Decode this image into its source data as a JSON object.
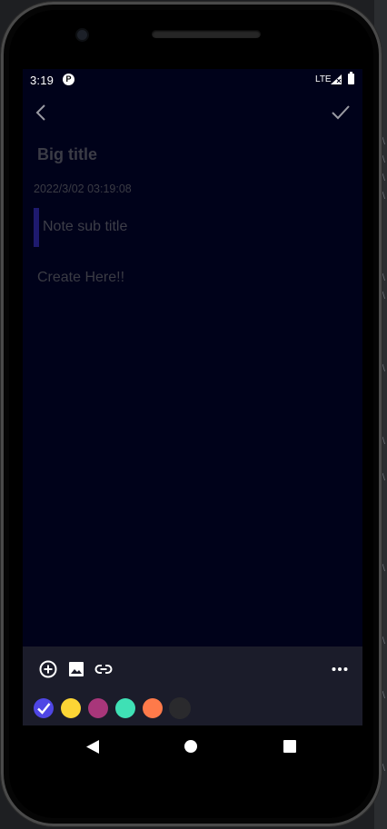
{
  "status_bar": {
    "time": "3:19",
    "app_badge": "P",
    "network": "LTE"
  },
  "header": {
    "back_icon": "chevron-left-icon",
    "save_icon": "check-icon"
  },
  "note": {
    "title": "Big title",
    "timestamp": "2022/3/02 03:19:08",
    "subtitle": "Note sub title",
    "body_placeholder": "Create Here!!"
  },
  "toolbar": {
    "actions": [
      "add-circle-icon",
      "image-icon",
      "link-icon",
      "more-horizontal-icon"
    ],
    "colors": [
      {
        "hex": "#4f46e5",
        "selected": true
      },
      {
        "hex": "#fcd535",
        "selected": false
      },
      {
        "hex": "#a8367a",
        "selected": false
      },
      {
        "hex": "#3fe0b5",
        "selected": false
      },
      {
        "hex": "#fe7a4a",
        "selected": false
      },
      {
        "hex": "#2a2a2d",
        "selected": false
      }
    ]
  },
  "nav_bar": {
    "buttons": [
      "back-triangle-icon",
      "home-circle-icon",
      "recents-square-icon"
    ]
  },
  "theme": {
    "screen_bg": "#00021a",
    "toolbar_bg": "#1b1c2a",
    "subtitle_accent": "#1e1a6e"
  }
}
